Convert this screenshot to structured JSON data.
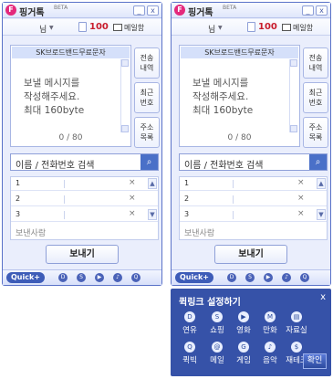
{
  "app": {
    "title": "핑거톡",
    "beta": "BETA"
  },
  "window_buttons": [
    "_",
    "x"
  ],
  "user": {
    "name": "님",
    "credit": "100",
    "mailbox": "메일함"
  },
  "message": {
    "header": "SK브로드밴드무료문자",
    "placeholder": "보낼 메시지를\n작성해주세요.\n최대 160byte",
    "counter": "0 / 80"
  },
  "side_buttons": [
    {
      "line1": "전송",
      "line2": "내역"
    },
    {
      "line1": "최근",
      "line2": "번호"
    },
    {
      "line1": "주소",
      "line2": "목록"
    }
  ],
  "search": {
    "placeholder": "이름 / 전화번호 검색"
  },
  "recipients": [
    {
      "num": "1"
    },
    {
      "num": "2"
    },
    {
      "num": "3"
    }
  ],
  "sender_label": "보낸사람",
  "send_button": "보내기",
  "quick": {
    "label": "Quick+"
  },
  "quick_panel": {
    "title": "퀵링크 설정하기",
    "close": "x",
    "items": [
      {
        "label": "연유",
        "icon": "D"
      },
      {
        "label": "쇼핑",
        "icon": "S"
      },
      {
        "label": "영화",
        "icon": "▶"
      },
      {
        "label": "만화",
        "icon": "M"
      },
      {
        "label": "자료실",
        "icon": "▤"
      },
      {
        "label": "퀵빅",
        "icon": "Q"
      },
      {
        "label": "메일",
        "icon": "@"
      },
      {
        "label": "게임",
        "icon": "G"
      },
      {
        "label": "음악",
        "icon": "♪"
      },
      {
        "label": "재테크",
        "icon": "$"
      }
    ],
    "confirm": "확인"
  },
  "colors": {
    "accent": "#3652a8",
    "credit": "#c81c2c",
    "logo": "#e4287c"
  }
}
